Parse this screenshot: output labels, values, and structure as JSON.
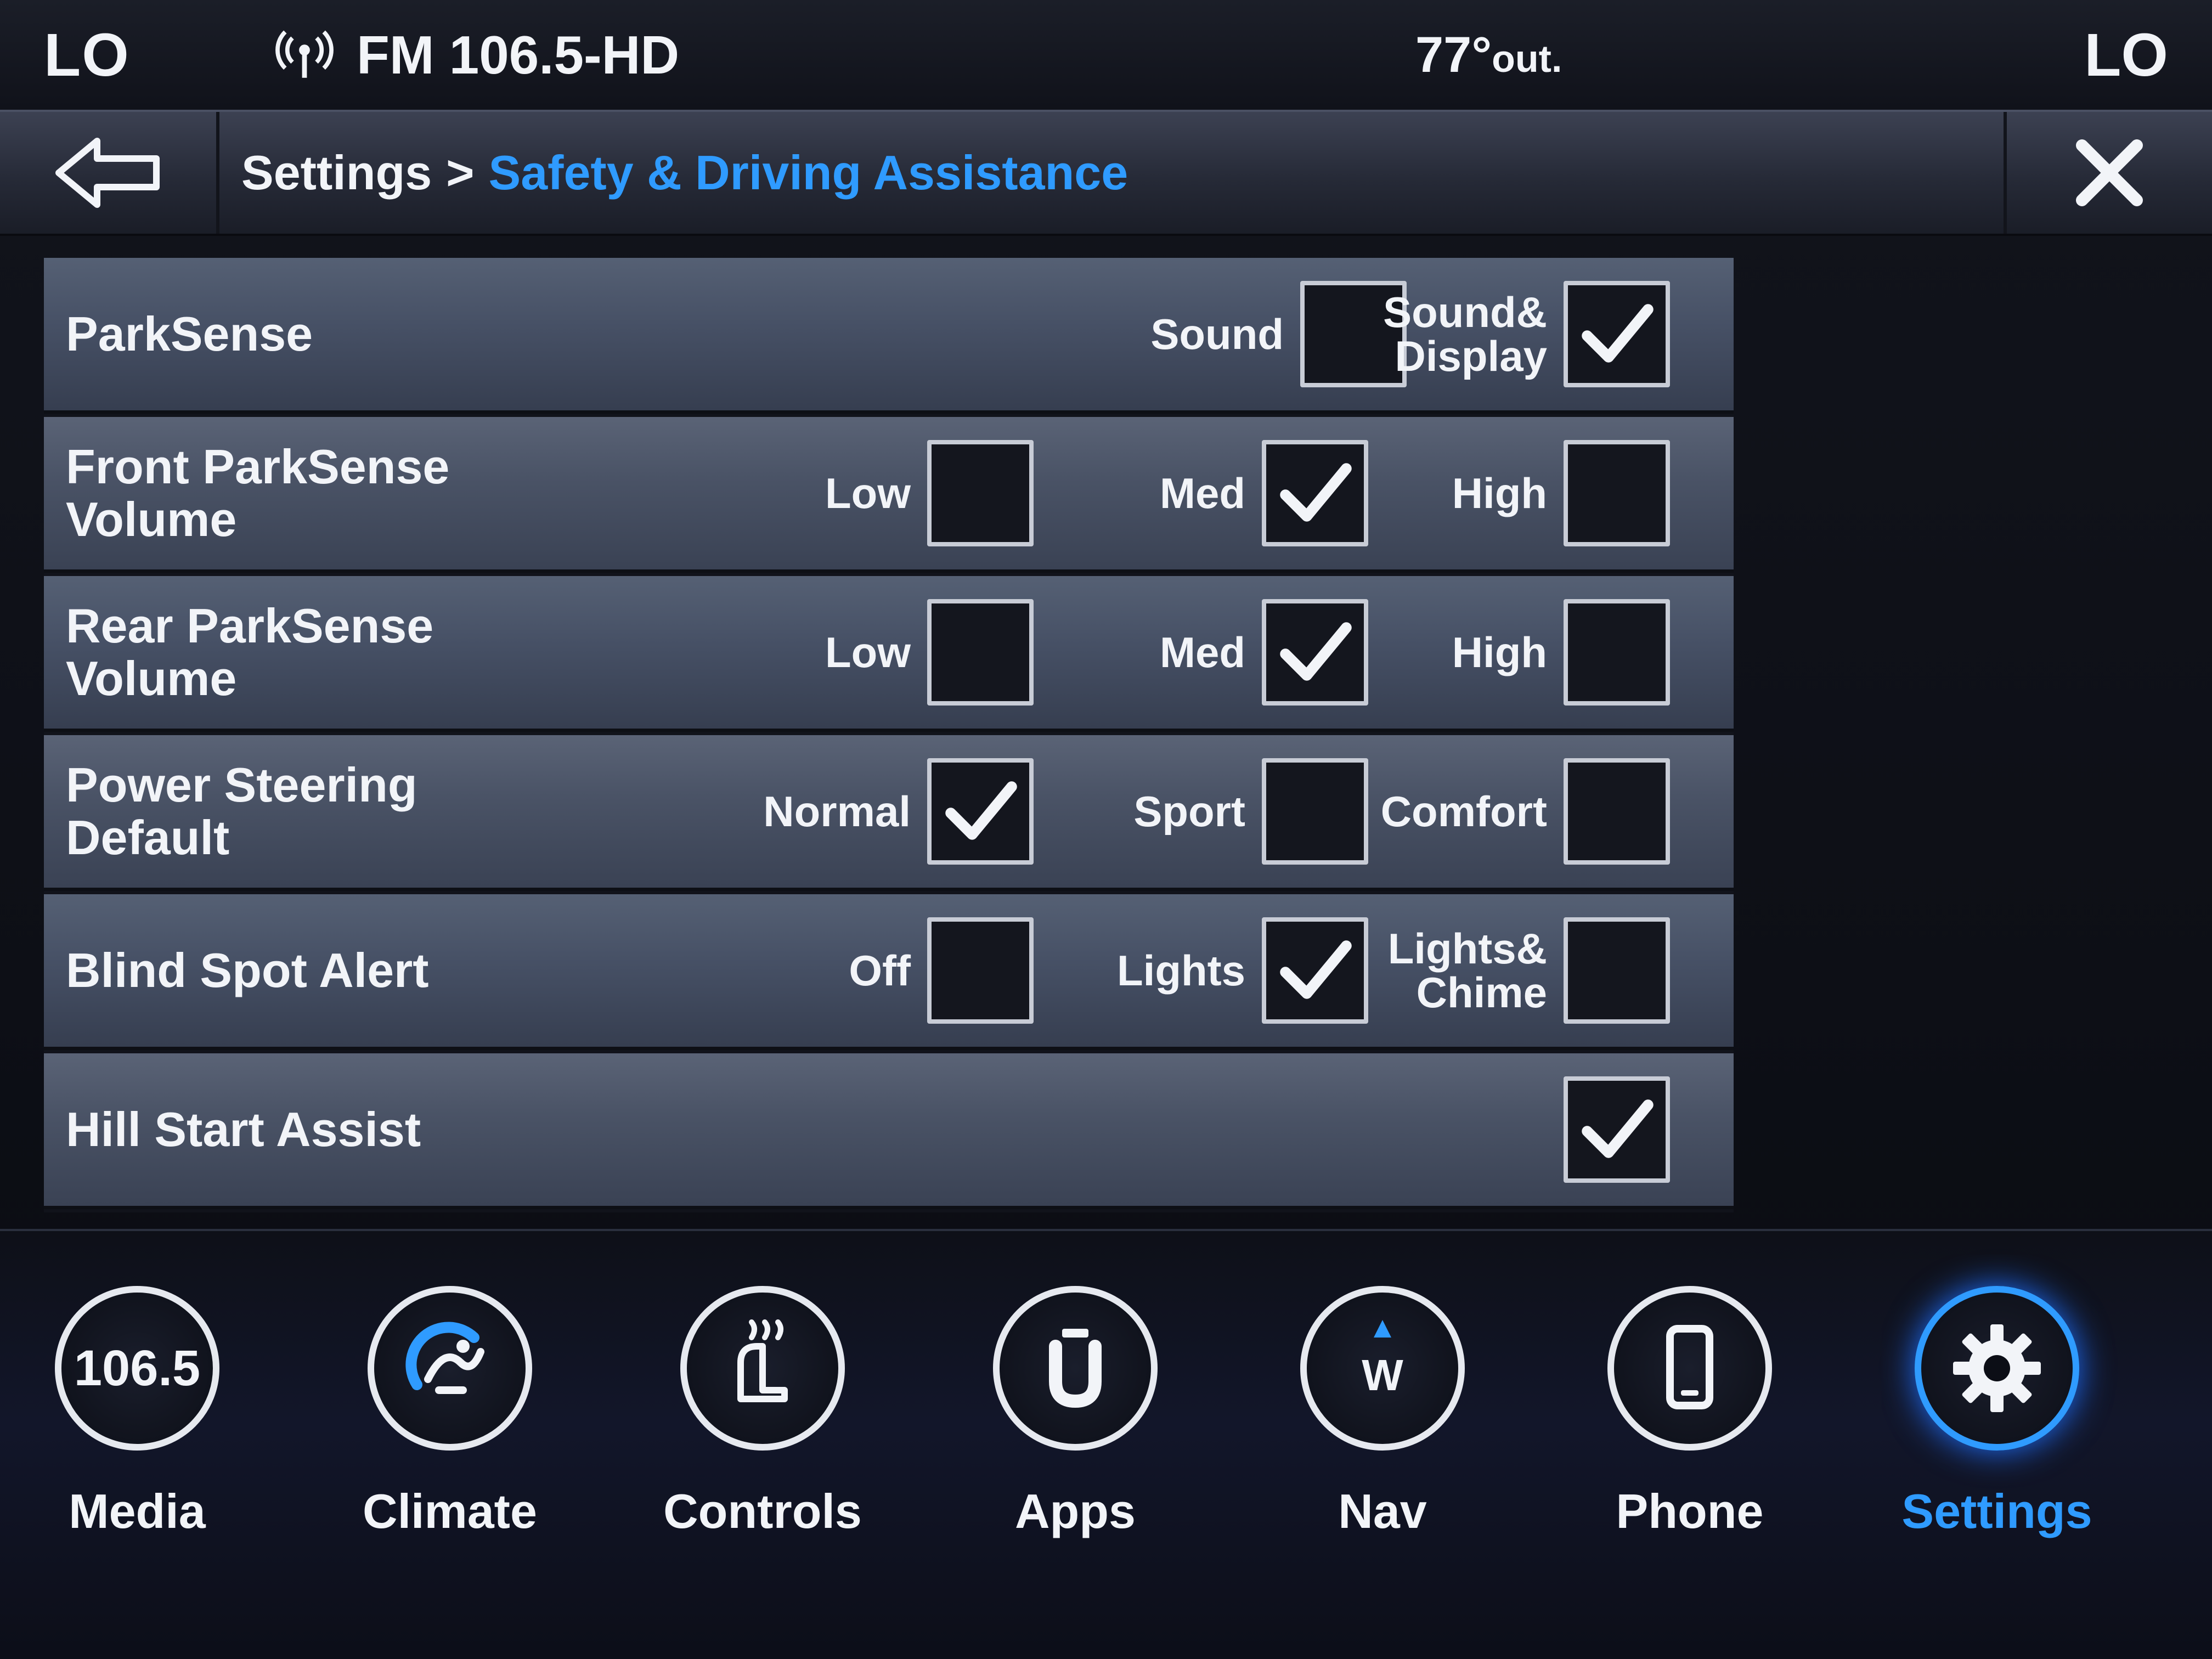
{
  "status": {
    "zone_left": "LO",
    "radio": "FM 106.5-HD",
    "temp_value": "77°",
    "temp_suffix": "out.",
    "zone_right": "LO"
  },
  "header": {
    "back_icon": "back-arrow-icon",
    "crumb_root": "Settings",
    "crumb_sep": ">",
    "crumb_current": "Safety & Driving Assistance",
    "close_icon": "close-icon",
    "accent_color": "#2f9bff"
  },
  "rows": [
    {
      "label": "ParkSense",
      "options": [
        {
          "label": "Sound",
          "checked": false
        },
        {
          "label": "Sound&\nDisplay",
          "checked": true
        }
      ]
    },
    {
      "label": "Front ParkSense\nVolume",
      "options": [
        {
          "label": "Low",
          "checked": false
        },
        {
          "label": "Med",
          "checked": true
        },
        {
          "label": "High",
          "checked": false
        }
      ]
    },
    {
      "label": "Rear ParkSense\nVolume",
      "options": [
        {
          "label": "Low",
          "checked": false
        },
        {
          "label": "Med",
          "checked": true
        },
        {
          "label": "High",
          "checked": false
        }
      ]
    },
    {
      "label": "Power Steering\nDefault",
      "options": [
        {
          "label": "Normal",
          "checked": true
        },
        {
          "label": "Sport",
          "checked": false
        },
        {
          "label": "Comfort",
          "checked": false
        }
      ]
    },
    {
      "label": "Blind Spot Alert",
      "options": [
        {
          "label": "Off",
          "checked": false
        },
        {
          "label": "Lights",
          "checked": true
        },
        {
          "label": "Lights&\nChime",
          "checked": false
        }
      ]
    },
    {
      "label": "Hill Start Assist",
      "options": [
        {
          "label": "",
          "checked": true
        }
      ]
    }
  ],
  "nav": [
    {
      "label": "Media",
      "icon": "media-icon",
      "icon_text": "106.5",
      "active": false
    },
    {
      "label": "Climate",
      "icon": "climate-icon",
      "active": false
    },
    {
      "label": "Controls",
      "icon": "controls-icon",
      "active": false
    },
    {
      "label": "Apps",
      "icon": "apps-icon",
      "active": false
    },
    {
      "label": "Nav",
      "icon": "nav-compass-icon",
      "icon_text": "W",
      "active": false
    },
    {
      "label": "Phone",
      "icon": "phone-icon",
      "active": false
    },
    {
      "label": "Settings",
      "icon": "settings-gear-icon",
      "active": true
    }
  ]
}
